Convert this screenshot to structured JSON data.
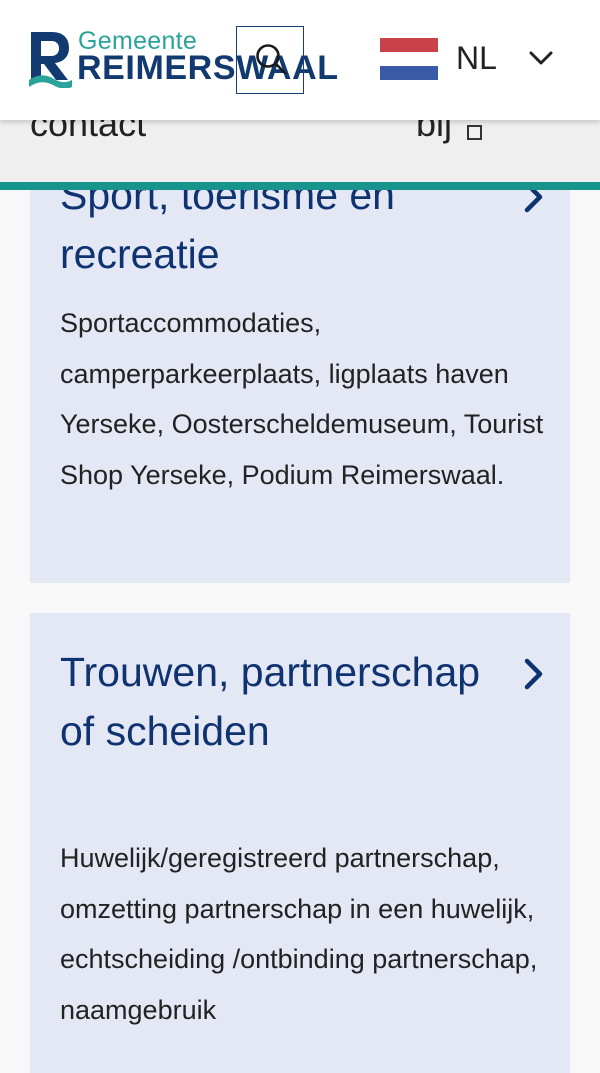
{
  "header": {
    "logo_sub": "Gemeente",
    "logo_main": "REIMERSWAAL",
    "search_icon": "search-icon",
    "language": {
      "code": "NL",
      "flag_colors": [
        "#c8414b",
        "#ffffff",
        "#3a5aa8"
      ],
      "chevron_icon": "chevron-down-icon"
    }
  },
  "subbar": {
    "contact_label": "contact",
    "bij_label": "bij",
    "external_icon": "external-link-icon"
  },
  "colors": {
    "brand_navy": "#133a70",
    "brand_teal": "#2aa39a",
    "card_bg": "#e3e8f4",
    "accent_line": "#17948c"
  },
  "cards": [
    {
      "title": "Sport, toerisme en recreatie",
      "description": "Sportaccommodaties, camperparkeerplaats, ligplaats haven Yerseke, Oosterscheldemuseum, Tourist Shop Yerseke, Podium Reimerswaal.",
      "chevron_icon": "chevron-right-icon"
    },
    {
      "title": "Trouwen, partnerschap of scheiden",
      "description": "Huwelijk/geregistreerd partnerschap, omzetting partnerschap in een huwelijk, echtscheiding /ontbinding partnerschap, naamgebruik",
      "chevron_icon": "chevron-right-icon"
    }
  ]
}
